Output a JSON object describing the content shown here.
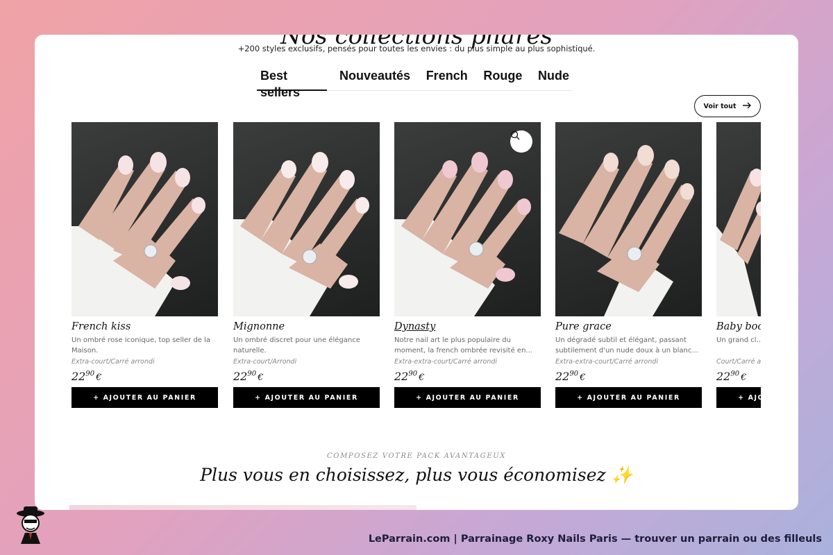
{
  "section": {
    "title_partial": "Nos collections phares",
    "subtitle": "+200 styles exclusifs, pensés pour toutes les envies : du plus simple au plus sophistiqué."
  },
  "tabs": [
    "Best sellers",
    "Nouveautés",
    "French",
    "Rouge",
    "Nude"
  ],
  "active_tab": "Best sellers",
  "voir_tout": "Voir tout",
  "products": [
    {
      "name": "French kiss",
      "desc": "Un ombré rose iconique, top seller de la Maison.",
      "shape": "Extra-court/Carré arrondi",
      "price_int": "22",
      "price_dec": "90",
      "currency": "€",
      "button": "+ AJOUTER AU PANIER"
    },
    {
      "name": "Mignonne",
      "desc": "Un ombré discret pour une élégance naturelle.",
      "shape": "Extra-court/Arrondi",
      "price_int": "22",
      "price_dec": "90",
      "currency": "€",
      "button": "+ AJOUTER AU PANIER"
    },
    {
      "name": "Dynasty",
      "desc": "Notre nail art le plus populaire du moment, la french ombrée revisité en...",
      "shape": "Extra-extra-court/Carré arrondi",
      "price_int": "22",
      "price_dec": "90",
      "currency": "€",
      "button": "+ AJOUTER AU PANIER"
    },
    {
      "name": "Pure grace",
      "desc": "Un dégradé subtil et élégant, passant subtilement d'un nude doux à un blanc...",
      "shape": "Extra-extra-court/Carré arrondi",
      "price_int": "22",
      "price_dec": "90",
      "currency": "€",
      "button": "+ AJOUTER AU PANIER"
    },
    {
      "name": "Baby boom",
      "desc": "Un grand cl... boomer ultim...",
      "shape": "Court/Carré arr...",
      "price_int": "22",
      "price_dec": "90",
      "currency": "€",
      "button": "+ AJOUTER AU PANIER"
    }
  ],
  "pack": {
    "eyebrow": "COMPOSEZ VOTRE PACK AVANTAGEUX",
    "title": "Plus vous en choisissez, plus vous économisez ✨"
  },
  "footer": {
    "text": "LeParrain.com | Parrainage Roxy Nails Paris — trouver un parrain ou des filleuls"
  },
  "colors": {
    "accent": "#000000",
    "text": "#111111",
    "muted": "#666666"
  }
}
